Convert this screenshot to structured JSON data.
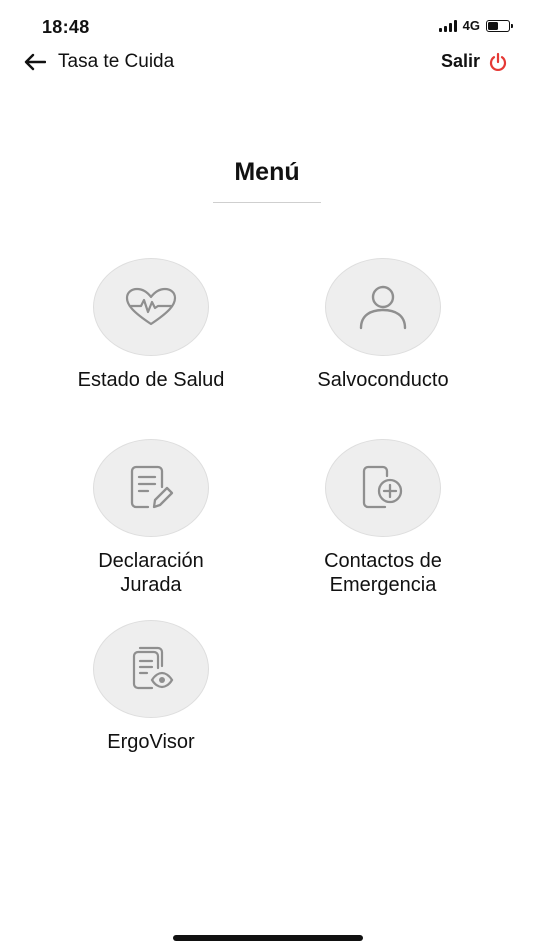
{
  "status_bar": {
    "time": "18:48",
    "network": "4G",
    "battery_level": 0.55
  },
  "header": {
    "back_label": "Tasa te Cuida",
    "back_icon": "arrow-left-icon",
    "logout_label": "Salir",
    "logout_icon": "power-icon",
    "logout_color": "#e53935"
  },
  "menu": {
    "title": "Menú",
    "items": [
      {
        "label": "Estado de Salud",
        "icon": "heart-pulse-icon"
      },
      {
        "label": "Salvoconducto",
        "icon": "user-icon"
      },
      {
        "label": "Declaración\nJurada",
        "icon": "document-edit-icon"
      },
      {
        "label": "Contactos de\nEmergencia",
        "icon": "phone-plus-icon"
      },
      {
        "label": "ErgoVisor",
        "icon": "document-eye-icon"
      }
    ]
  },
  "colors": {
    "icon_gray": "#8f8f8f",
    "circle_bg": "#eeeeee"
  }
}
